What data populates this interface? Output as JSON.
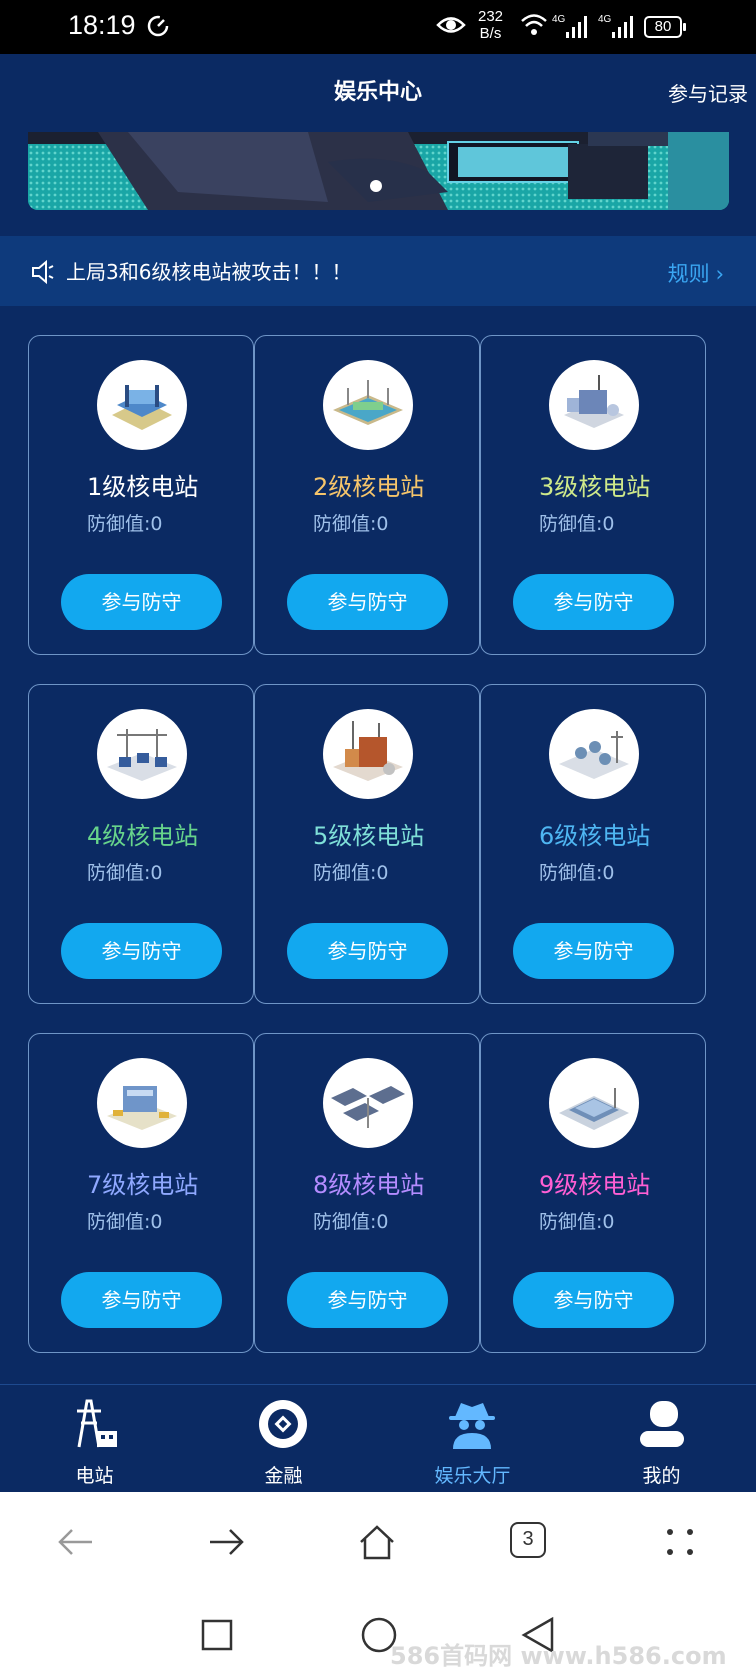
{
  "status_bar": {
    "time": "18:19",
    "net_speed_value": "232",
    "net_speed_unit": "B/s",
    "signal_1": "4G",
    "signal_2": "4G",
    "battery": "80"
  },
  "header": {
    "title": "娱乐中心",
    "record_link": "参与记录"
  },
  "notice": {
    "text": "上局3和6级核电站被攻击！！！",
    "rules_label": "规则"
  },
  "stations": [
    {
      "name": "1级核电站",
      "defense_label": "防御值:0",
      "button": "参与防守",
      "color": "#ffffff"
    },
    {
      "name": "2级核电站",
      "defense_label": "防御值:0",
      "button": "参与防守",
      "color": "#f6c56b"
    },
    {
      "name": "3级核电站",
      "defense_label": "防御值:0",
      "button": "参与防守",
      "color": "#cfe98a"
    },
    {
      "name": "4级核电站",
      "defense_label": "防御值:0",
      "button": "参与防守",
      "color": "#67d48b"
    },
    {
      "name": "5级核电站",
      "defense_label": "防御值:0",
      "button": "参与防守",
      "color": "#7fe0d8"
    },
    {
      "name": "6级核电站",
      "defense_label": "防御值:0",
      "button": "参与防守",
      "color": "#4fb6f2"
    },
    {
      "name": "7级核电站",
      "defense_label": "防御值:0",
      "button": "参与防守",
      "color": "#8fa8ff"
    },
    {
      "name": "8级核电站",
      "defense_label": "防御值:0",
      "button": "参与防守",
      "color": "#b48cff"
    },
    {
      "name": "9级核电站",
      "defense_label": "防御值:0",
      "button": "参与防守",
      "color": "#ff5fd4"
    }
  ],
  "bottom_nav": [
    {
      "label": "电站",
      "icon": "power-tower-icon",
      "active": false
    },
    {
      "label": "金融",
      "icon": "coin-icon",
      "active": false
    },
    {
      "label": "娱乐大厅",
      "icon": "spy-icon",
      "active": true
    },
    {
      "label": "我的",
      "icon": "user-icon",
      "active": false
    }
  ],
  "browser": {
    "tab_count": "3"
  },
  "watermark": "586首码网 www.h586.com",
  "colors": {
    "background": "#0b2a63",
    "accent": "#12a8ef",
    "active_nav": "#63b8ff"
  }
}
